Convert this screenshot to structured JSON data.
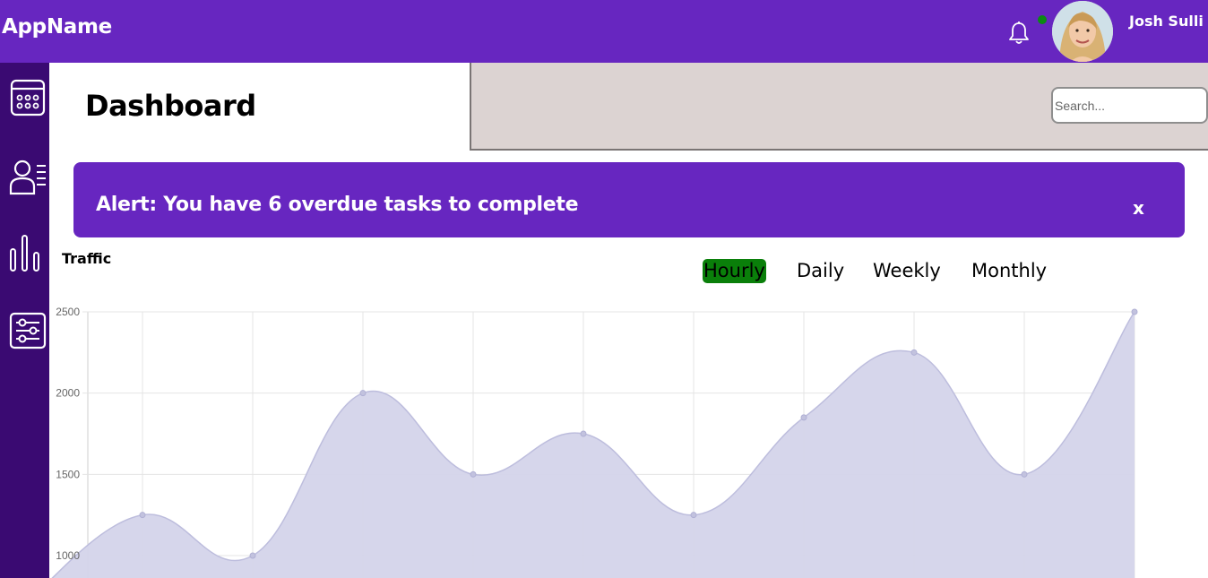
{
  "header": {
    "app_name": "AppName",
    "user_name": "Josh Sulli",
    "notification_status_color": "#0b8a14"
  },
  "sidebar": {
    "items": [
      {
        "icon": "calendar-icon"
      },
      {
        "icon": "members-icon"
      },
      {
        "icon": "chart-icon"
      },
      {
        "icon": "settings-sliders-icon"
      }
    ]
  },
  "main": {
    "page_title": "Dashboard",
    "search": {
      "placeholder": "Search...",
      "value": ""
    }
  },
  "alert": {
    "text": "Alert: You have 6 overdue tasks to complete",
    "close_label": "x"
  },
  "traffic": {
    "label": "Traffic",
    "tabs": [
      {
        "label": "Hourly",
        "active": true
      },
      {
        "label": "Daily",
        "active": false
      },
      {
        "label": "Weekly",
        "active": false
      },
      {
        "label": "Monthly",
        "active": false
      }
    ]
  },
  "colors": {
    "brand": "#6726c0",
    "sidebar": "#3a0a72",
    "active_tab": "#0a7f0a",
    "chart_fill": "#d4d4ea",
    "chart_line": "#bdbddd"
  },
  "chart_data": {
    "type": "area",
    "x_count": 11,
    "values": [
      750,
      1250,
      1000,
      2000,
      1500,
      1750,
      1250,
      1850,
      2250,
      1500,
      2500
    ],
    "yticks": [
      1000,
      1500,
      2000,
      2500
    ],
    "ylim_visible": [
      850,
      2500
    ],
    "grid": true,
    "smooth": true
  }
}
